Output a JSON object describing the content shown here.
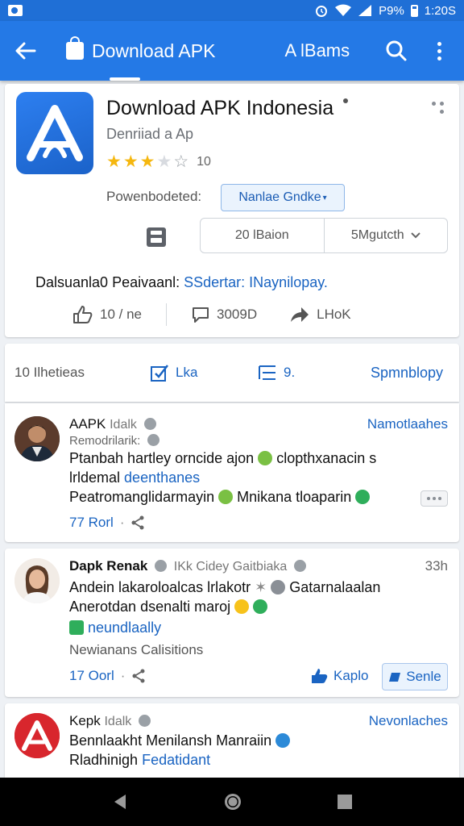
{
  "status_bar": {
    "time": "1:20S",
    "battery": "P9%"
  },
  "app_bar": {
    "tab_active": "Download APK",
    "tab_secondary": "A lBams"
  },
  "app": {
    "title": "Download APK Indonesia",
    "subtitle": "Denriiad a Ap",
    "rating_count": "10",
    "rating_value": 3.5,
    "powered_label": "Powenbodeted:",
    "primary_button": "Nanlae Gndke",
    "segment_left": "20 lBaion",
    "segment_right": "5Mgutcth",
    "description_prefix": "Dalsuanla0 Peaivaanl:",
    "description_link": "SSdertar: INaynilopay.",
    "like_count": "10 / ne",
    "comment_count": "3009D",
    "share_label": "LHoK"
  },
  "comments_header": {
    "count_label": "10 Ilhetieas",
    "filter_label": "Lka",
    "sort_label": "9.",
    "right_label": "Spmnblopy"
  },
  "posts": [
    {
      "name": "AAPK",
      "handle": "Idalk",
      "meta": "Remodrilarik:",
      "tag": "Namotlaahes",
      "line1": "Ptanbah hartley orncide ajon",
      "line1_tail": "clopthxanacin s",
      "line2_prefix": "lrldemal",
      "line2_link": "deenthanes",
      "line3": "Peatromanglidarmayin",
      "line3_tail": "Mnikana tloaparin",
      "footer": "77 Rorl"
    },
    {
      "name": "Dapk Renak",
      "handle": "IKk Cidey Gaitbiaka",
      "time": "33h",
      "line1": "Andein lakaroloalcas lrlakotr",
      "line1_tail": "Gatarnalaalan",
      "line2": "Anerotdan dsenalti maroj",
      "line3_link": "neundlaally",
      "line4": "Newianans Calisitions",
      "footer": "17 Oorl",
      "like_label": "Kaplo",
      "reply_label": "Senle"
    },
    {
      "name": "Kepk",
      "handle": "Idalk",
      "tag": "Nevonlaches",
      "line1": "Bennlaakht Menilansh Manraiin",
      "line2_prefix": "Rladhinigh",
      "line2_link": "Fedatidant"
    }
  ],
  "colors": {
    "brand": "#2479e6",
    "link": "#1a64c2",
    "star": "#f5b70f"
  }
}
